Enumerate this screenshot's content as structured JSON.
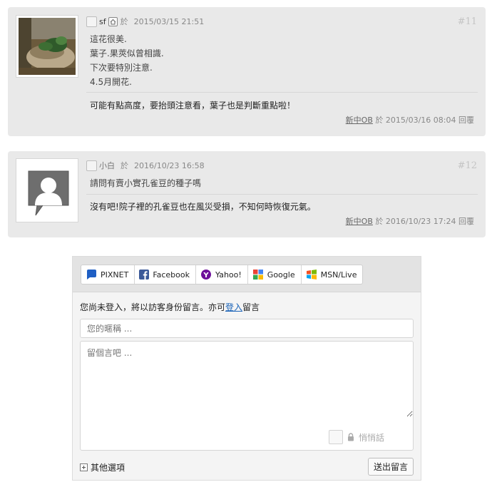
{
  "comments": [
    {
      "author": "sf",
      "preposition": "於",
      "datetime": "2015/03/15 21:51",
      "number": "#11",
      "lines": [
        "這花很美.",
        "葉子.果莢似曾相識.",
        "下次要特別注意.",
        "4.5月開花."
      ],
      "reply": {
        "text": "可能有點高度，要抬頭注意看，葉子也是判斷重點啦！",
        "author": "新中OB",
        "preposition": "於",
        "datetime": "2015/03/16 08:04",
        "action": "回覆"
      }
    },
    {
      "author": "小白",
      "preposition": "於",
      "datetime": "2016/10/23 16:58",
      "number": "#12",
      "lines": [
        "請問有賣小實孔雀豆的種子嗎"
      ],
      "reply": {
        "text": "沒有吧!院子裡的孔雀豆也在風災受損，不知何時恢復元氣。",
        "author": "新中OB",
        "preposition": "於",
        "datetime": "2016/10/23 17:24",
        "action": "回覆"
      }
    }
  ],
  "form": {
    "tabs": [
      {
        "label": "PIXNET",
        "icon": "pixnet-icon",
        "color": "#1f5fc4"
      },
      {
        "label": "Facebook",
        "icon": "facebook-icon",
        "color": "#3b5998"
      },
      {
        "label": "Yahoo!",
        "icon": "yahoo-icon",
        "color": "#6d0f9a"
      },
      {
        "label": "Google",
        "icon": "google-icon",
        "color": "#34a853"
      },
      {
        "label": "MSN/Live",
        "icon": "msn-icon",
        "color": "#e8711a"
      }
    ],
    "login_prefix": "您尚未登入，將以訪客身份留言。亦可",
    "login_link": "登入",
    "login_suffix": "留言",
    "nickname_placeholder": "您的暱稱 ...",
    "message_placeholder": "留個言吧 ...",
    "secret_label": "悄悄話",
    "more_options": "其他選項",
    "submit": "送出留言"
  }
}
